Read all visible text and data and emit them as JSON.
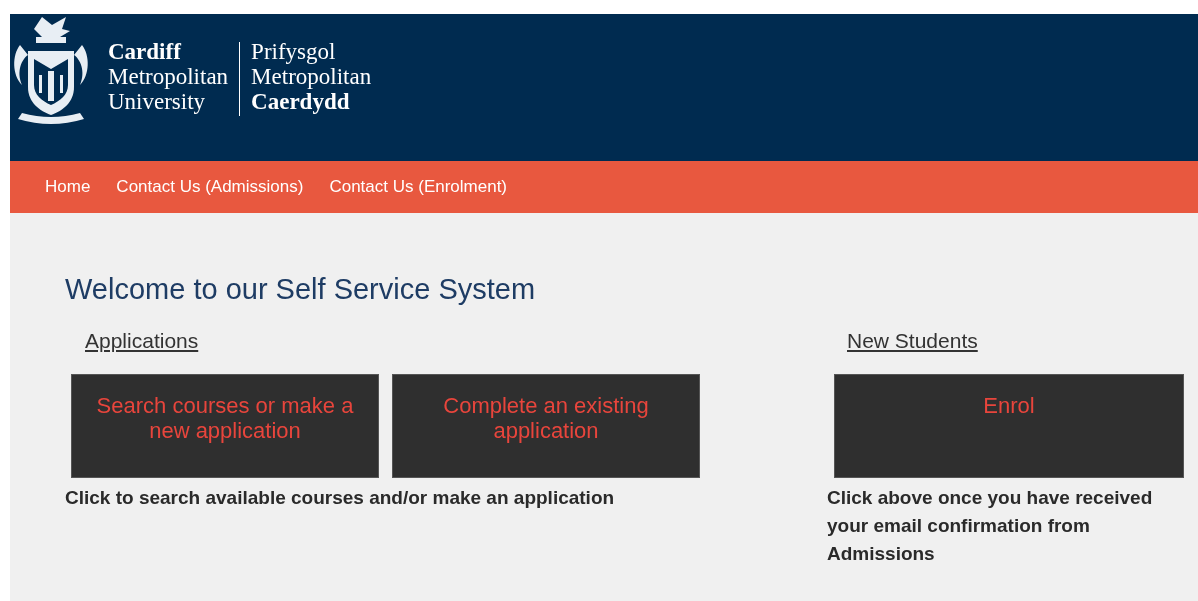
{
  "header": {
    "logo_left": [
      "Cardiff",
      "Metropolitan",
      "University"
    ],
    "logo_right": [
      "Prifysgol",
      "Metropolitan",
      "Caerdydd"
    ]
  },
  "nav": [
    {
      "label": "Home"
    },
    {
      "label": "Contact Us (Admissions)"
    },
    {
      "label": "Contact Us (Enrolment)"
    }
  ],
  "heading": "Welcome to our Self Service System",
  "sections": [
    {
      "title": "Applications",
      "buttons": [
        "Search courses or make a new application",
        "Complete an existing application"
      ],
      "caption": "Click to search available courses and/or make an application"
    },
    {
      "title": "New Students",
      "buttons": [
        "Enrol"
      ],
      "caption": "Click above once you have received your email confirmation from Admissions"
    }
  ]
}
